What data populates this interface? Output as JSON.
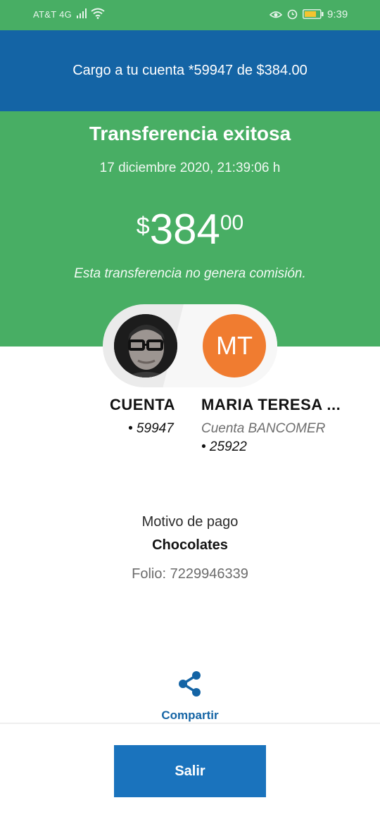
{
  "status_bar": {
    "carrier": "AT&T 4G",
    "time": "9:39",
    "icons": [
      "signal-icon",
      "wifi-icon",
      "eye-icon",
      "alarm-icon",
      "battery-icon"
    ]
  },
  "banner": {
    "text": "Cargo a tu cuenta *59947 de $384.00"
  },
  "transfer": {
    "title": "Transferencia exitosa",
    "datetime": "17 diciembre 2020, 21:39:06 h",
    "amount_currency": "$",
    "amount_integer": "384",
    "amount_decimals": "00",
    "fee_note": "Esta transferencia no genera comisión."
  },
  "origin": {
    "name": "CUENTA",
    "account": "• 59947"
  },
  "destination": {
    "initials": "MT",
    "name": "MARIA TERESA ...",
    "bank": "Cuenta BANCOMER",
    "account": "• 25922"
  },
  "payment": {
    "concept_label": "Motivo de pago",
    "concept_value": "Chocolates",
    "folio": "Folio: 7229946339"
  },
  "actions": {
    "share_label": "Compartir",
    "exit_label": "Salir"
  },
  "colors": {
    "green": "#48ae64",
    "blue_banner": "#1464a5",
    "button_blue": "#1a73bd",
    "avatar_orange": "#f07c30"
  }
}
